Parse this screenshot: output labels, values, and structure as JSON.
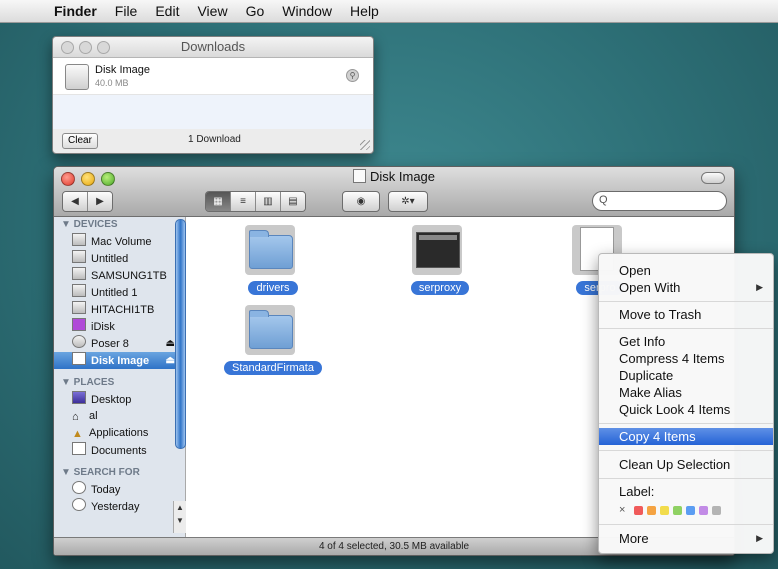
{
  "menubar": {
    "apple": "",
    "items": [
      "Finder",
      "File",
      "Edit",
      "View",
      "Go",
      "Window",
      "Help"
    ]
  },
  "downloads": {
    "title": "Downloads",
    "item_name": "Disk Image",
    "item_size": "40.0 MB",
    "clear_label": "Clear",
    "count": "1 Download"
  },
  "finder": {
    "title": "Disk Image",
    "search_placeholder": "Q",
    "status": "4 of 4 selected, 30.5 MB available",
    "sidebar": {
      "devices_header": "▼ DEVICES",
      "devices": [
        "Mac Volume",
        "Untitled",
        "SAMSUNG1TB",
        "Untitled 1",
        "HITACHI1TB",
        "iDisk",
        "Poser 8",
        "Disk Image"
      ],
      "places_header": "▼ PLACES",
      "places": [
        "Desktop",
        "al",
        "Applications",
        "Documents"
      ],
      "search_header": "▼ SEARCH FOR",
      "search": [
        "Today",
        "Yesterday"
      ]
    },
    "files": [
      {
        "name": "drivers",
        "kind": "folder"
      },
      {
        "name": "serproxy",
        "kind": "app"
      },
      {
        "name": "serpro",
        "kind": "document"
      },
      {
        "name": "StandardFirmata",
        "kind": "folder"
      }
    ]
  },
  "context_menu": {
    "open": "Open",
    "open_with": "Open With",
    "move_to_trash": "Move to Trash",
    "get_info": "Get Info",
    "compress": "Compress 4 Items",
    "duplicate": "Duplicate",
    "make_alias": "Make Alias",
    "quick_look": "Quick Look 4 Items",
    "copy": "Copy 4 Items",
    "clean_up": "Clean Up Selection",
    "label": "Label:",
    "label_none": "×",
    "label_colors": [
      "#f05a5a",
      "#f5a342",
      "#f2dc4c",
      "#8fd163",
      "#5b9df2",
      "#c28be6",
      "#b4b4b4"
    ],
    "more": "More"
  }
}
